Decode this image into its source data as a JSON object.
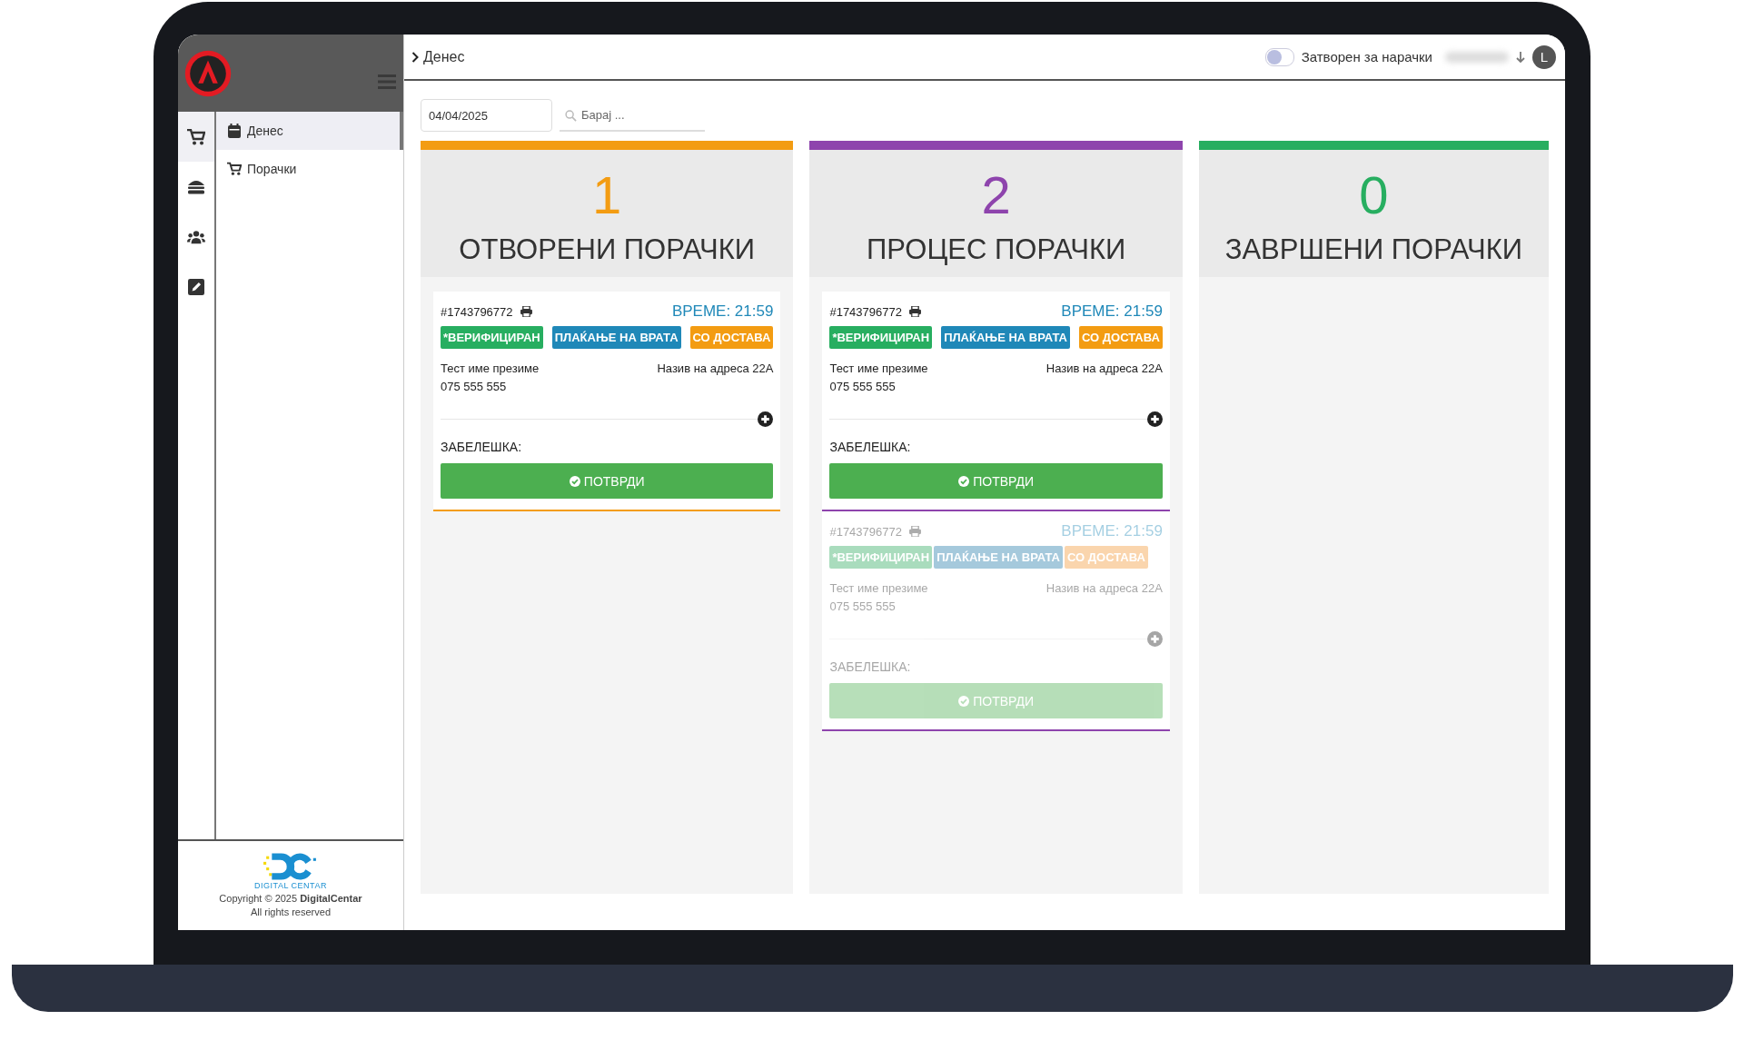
{
  "sidebar": {
    "rail": [
      {
        "kind": "cart",
        "selected": true
      },
      {
        "kind": "burger",
        "selected": false
      },
      {
        "kind": "users",
        "selected": false
      },
      {
        "kind": "edit",
        "selected": false
      }
    ],
    "menu": [
      {
        "kind": "calendar",
        "label": "Денес",
        "selected": true
      },
      {
        "kind": "cart",
        "label": "Порачки",
        "selected": false
      }
    ],
    "footer": {
      "logo_text": "DIGITAL CENTAR",
      "copyright": "Copyright © 2025 **DigitalCentar**",
      "rights": "All rights reserved"
    }
  },
  "header": {
    "breadcrumb": "Денес",
    "toggle": {
      "label": "Затворен за нарачки",
      "on": false
    },
    "avatar": "L"
  },
  "filters": {
    "date": "04/04/2025",
    "search_placeholder": "Барај ..."
  },
  "columns": [
    {
      "count": "1",
      "title": "ОТВОРЕНИ ПОРАЧКИ",
      "color": "#f39c12",
      "orders": [
        {
          "id": "#1743796772",
          "time": "ВРЕМЕ: 21:59",
          "dimmed": false,
          "tags": [
            {
              "label": "*ВЕРИФИЦИРАН",
              "color": "#27ae60"
            },
            {
              "label": "ПЛАЌАЊЕ НА ВРАТА",
              "color": "#1f88b8"
            },
            {
              "label": "СО ДОСТАВА",
              "color": "#f39c12"
            }
          ],
          "name": "Тест име презиме",
          "phone": "075 555 555",
          "address": "Назив на адреса 22A",
          "note_label": "ЗАБЕЛЕШКА:",
          "confirm": "ПОТВРДИ"
        }
      ]
    },
    {
      "count": "2",
      "title": "ПРОЦЕС ПОРАЧКИ",
      "color": "#8e44ad",
      "orders": [
        {
          "id": "#1743796772",
          "time": "ВРЕМЕ: 21:59",
          "dimmed": false,
          "tags": [
            {
              "label": "*ВЕРИФИЦИРАН",
              "color": "#27ae60"
            },
            {
              "label": "ПЛАЌАЊЕ НА ВРАТА",
              "color": "#1f88b8"
            },
            {
              "label": "СО ДОСТАВА",
              "color": "#f39c12"
            }
          ],
          "name": "Тест име презиме",
          "phone": "075 555 555",
          "address": "Назив на адреса 22A",
          "note_label": "ЗАБЕЛЕШКА:",
          "confirm": "ПОТВРДИ"
        },
        {
          "id": "#1743796772",
          "time": "ВРЕМЕ: 21:59",
          "dimmed": true,
          "tags": [
            {
              "label": "*ВЕРИФИЦИРАН",
              "color": "#a9dcbd"
            },
            {
              "label": "ПЛАЌАЊЕ НА ВРАТА",
              "color": "#a5c9dc"
            },
            {
              "label": "СО ДОСТАВА",
              "color": "#fad5ad"
            }
          ],
          "name": "Тест име презиме",
          "phone": "075 555 555",
          "address": "Назив на адреса 22A",
          "note_label": "ЗАБЕЛЕШКА:",
          "confirm": "ПОТВРДИ"
        }
      ]
    },
    {
      "count": "0",
      "title": "ЗАВРШЕНИ ПОРАЧКИ",
      "color": "#27ae60"
    }
  ]
}
